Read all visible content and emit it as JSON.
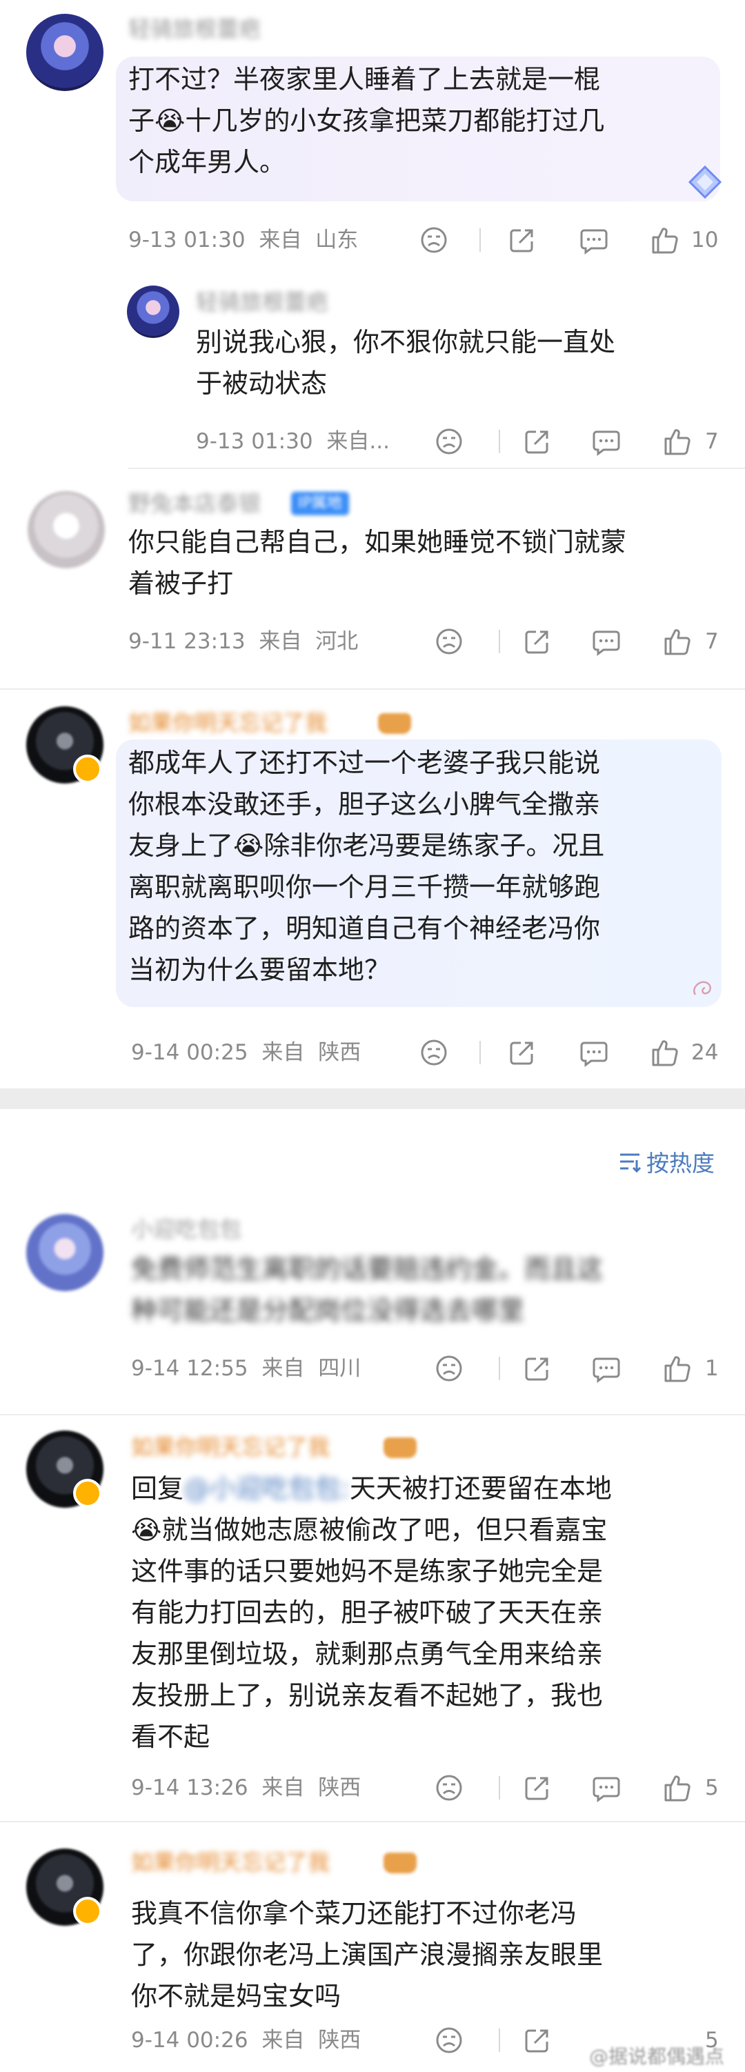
{
  "comments": [
    {
      "name": "轻骑旅根蕾疤",
      "text": "打不过？半夜家里人睡着了上去就是一棍\n子😭十几岁的小女孩拿把菜刀都能打过几\n个成年男人。",
      "date": "9-13 01:30",
      "from": "来自",
      "location": "山东",
      "likes": "10"
    },
    {
      "name": "轻骑旅根蕾疤",
      "text": "别说我心狠，你不狠你就只能一直处\n于被动状态",
      "date": "9-13 01:30",
      "from": "来自...",
      "likes": "7"
    },
    {
      "name": "野兔本店泰银",
      "tag": "IP属地",
      "text": "你只能自己帮自己，如果她睡觉不锁门就蒙\n着被子打",
      "date": "9-11 23:13",
      "from": "来自",
      "location": "河北",
      "likes": "7"
    },
    {
      "name": "如果你明天忘记了我",
      "text": "都成年人了还打不过一个老婆子我只能说\n你根本没敢还手，胆子这么小脾气全撒亲\n友身上了😭除非你老冯要是练家子。况且\n离职就离职呗你一个月三千攒一年就够跑\n路的资本了，明知道自己有个神经老冯你\n当初为什么要留本地？",
      "date": "9-14 00:25",
      "from": "来自",
      "location": "陕西",
      "likes": "24"
    },
    {
      "name": "小迎吃包包",
      "text": "免费师范生离职的话要赔违约金。而且这\n种可能还是分配岗位没得选去哪里",
      "date": "9-14 12:55",
      "from": "来自",
      "location": "四川",
      "likes": "1"
    },
    {
      "name": "如果你明天忘记了我",
      "reply_prefix": "回复",
      "reply_target": "@小迎吃包包:",
      "text_line1": "天天被打还要留在本地",
      "text": "😭就当做她志愿被偷改了吧，但只看嘉宝\n这件事的话只要她妈不是练家子她完全是\n有能力打回去的，胆子被吓破了天天在亲\n友那里倒垃圾，就剩那点勇气全用来给亲\n友投册上了，别说亲友看不起她了，我也\n看不起",
      "date": "9-14 13:26",
      "from": "来自",
      "location": "陕西",
      "likes": "5"
    },
    {
      "name": "如果你明天忘记了我",
      "text": "我真不信你拿个菜刀还能打不过你老冯\n了，你跟你老冯上演国产浪漫搁亲友眼里\n你不就是妈宝女吗",
      "date": "9-14 00:26",
      "from": "来自",
      "location": "陕西",
      "likes": "5"
    }
  ],
  "sort_label": "按热度",
  "watermark": "@据说都偶遇点"
}
